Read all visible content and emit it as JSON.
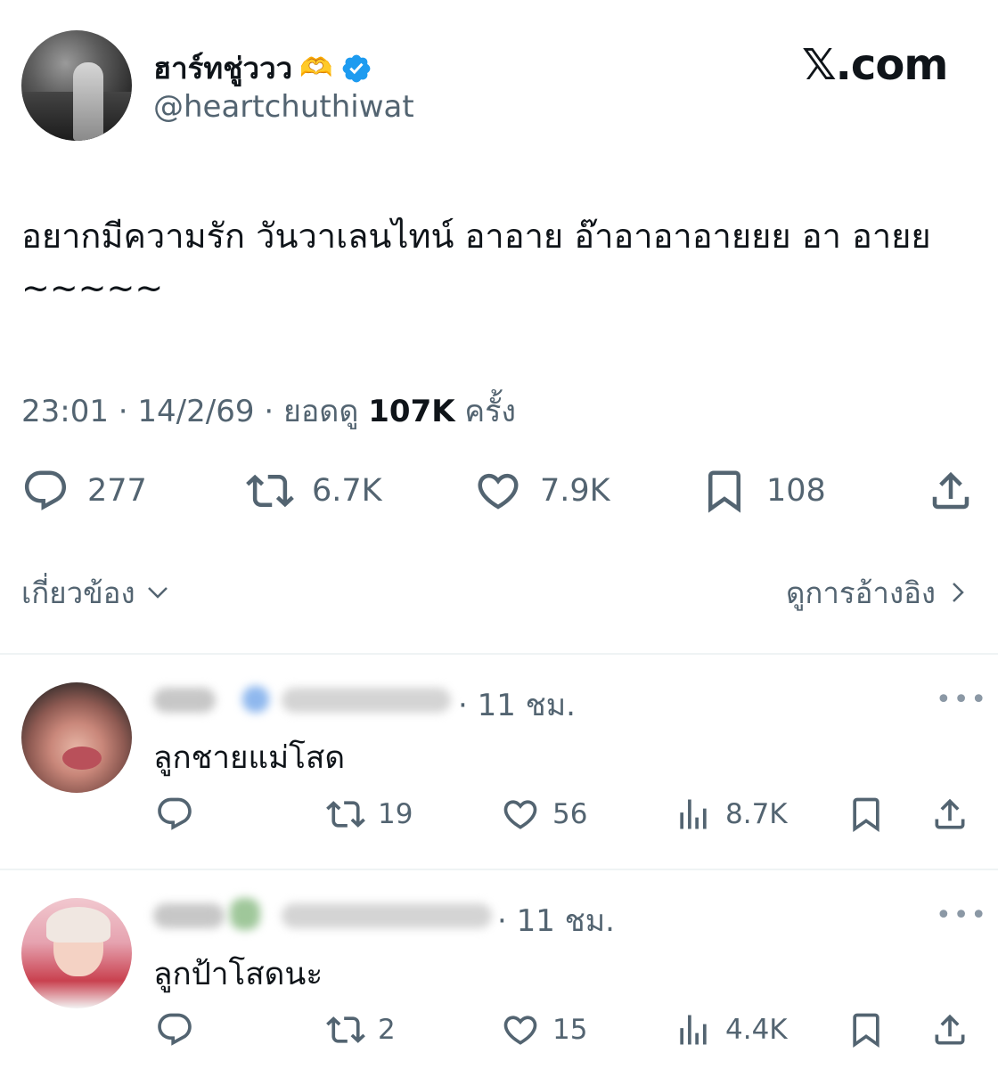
{
  "author": {
    "display_name": "ฮาร์ทชู่ววว",
    "heart_hands_emoji": "🫶",
    "handle": "@heartchuthiwat"
  },
  "site_logo": "𝕏.com",
  "tweet": {
    "text": "อยากมีความรัก วันวาเลนไทน์ อาอาย อ๊าอาอาอายยย อา อายย ~~~~~",
    "time": "23:01",
    "sep1": "·",
    "date": "14/2/69",
    "sep2": "·",
    "views_label": "ยอดดู",
    "views_count": "107K",
    "views_suffix": "ครั้ง"
  },
  "actions": {
    "replies": "277",
    "reposts": "6.7K",
    "likes": "7.9K",
    "bookmarks": "108"
  },
  "related": {
    "label": "เกี่ยวข้อง",
    "quotes_label": "ดูการอ้างอิง"
  },
  "replies": [
    {
      "time": "· 11 ชม.",
      "text": "ลูกชายแม่โสด",
      "replies": "",
      "reposts": "19",
      "likes": "56",
      "views": "8.7K"
    },
    {
      "time": "· 11 ชม.",
      "text": "ลูกป้าโสดนะ",
      "replies": "",
      "reposts": "2",
      "likes": "15",
      "views": "4.4K"
    }
  ],
  "icons": {
    "verified": "verified-badge-icon",
    "reply": "speech-bubble-icon",
    "repost": "repost-arrows-icon",
    "like": "heart-icon",
    "bookmark": "bookmark-icon",
    "share": "share-upload-icon",
    "views": "bar-chart-icon",
    "more": "more-dots-icon"
  },
  "colors": {
    "text": "#0f1419",
    "secondary": "#536471",
    "verified_blue": "#1d9bf0",
    "divider": "#eff3f4"
  }
}
